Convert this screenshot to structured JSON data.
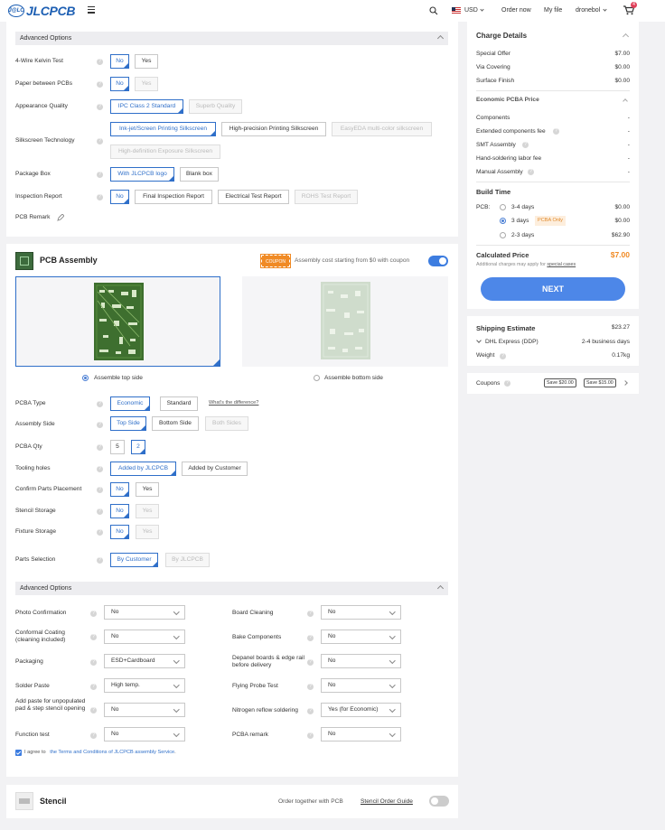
{
  "header": {
    "logo_mark": "J@LC",
    "logo_text": "JLCPCB",
    "currency": "USD",
    "order_now": "Order now",
    "my_file": "My file",
    "user": "dronebol",
    "cart_count": "4"
  },
  "adv1": {
    "title": "Advanced Options",
    "kelvin": {
      "label": "4-Wire Kelvin Test",
      "opts": [
        "No",
        "Yes"
      ]
    },
    "paper": {
      "label": "Paper between PCBs",
      "opts": [
        "No",
        "Yes"
      ]
    },
    "appearance": {
      "label": "Appearance Quality",
      "opts": [
        "IPC Class 2 Standard",
        "Superb Quality"
      ]
    },
    "silkscreen": {
      "label": "Silkscreen Technology",
      "opts": [
        "Ink-jet/Screen Printing Silkscreen",
        "High-precision Printing Silkscreen",
        "EasyEDA multi-color silkscreen",
        "High-definition Exposure Silkscreen"
      ]
    },
    "package": {
      "label": "Package Box",
      "opts": [
        "With JLCPCB logo",
        "Blank box"
      ]
    },
    "inspection": {
      "label": "Inspection Report",
      "opts": [
        "No",
        "Final Inspection Report",
        "Electrical Test Report",
        "ROHS Test Report"
      ]
    },
    "remark": {
      "label": "PCB Remark"
    }
  },
  "assembly": {
    "title": "PCB Assembly",
    "coupon_tag": "COUPON",
    "coupon_text": "Assembly cost starting from $0 with coupon",
    "side_top": "Assemble top side",
    "side_bottom": "Assemble bottom side",
    "pcba_type": {
      "label": "PCBA Type",
      "opts": [
        "Economic",
        "Standard"
      ],
      "link": "What's the difference?"
    },
    "assembly_side": {
      "label": "Assembly Side",
      "opts": [
        "Top Side",
        "Bottom Side",
        "Both Sides"
      ]
    },
    "qty": {
      "label": "PCBA Qty",
      "opts": [
        "5",
        "2"
      ]
    },
    "tooling": {
      "label": "Tooling holes",
      "opts": [
        "Added by JLCPCB",
        "Added by Customer"
      ]
    },
    "confirm": {
      "label": "Confirm Parts Placement",
      "opts": [
        "No",
        "Yes"
      ]
    },
    "stencil_storage": {
      "label": "Stencil Storage",
      "opts": [
        "No",
        "Yes"
      ]
    },
    "fixture": {
      "label": "Fixture Storage",
      "opts": [
        "No",
        "Yes"
      ]
    },
    "parts": {
      "label": "Parts Selection",
      "opts": [
        "By Customer",
        "By JLCPCB"
      ]
    }
  },
  "adv2": {
    "title": "Advanced Options",
    "left": [
      {
        "label": "Photo Confirmation",
        "value": "No"
      },
      {
        "label": "Conformal Coating (cleaning included)",
        "value": "No"
      },
      {
        "label": "Packaging",
        "value": "ESD+Cardboard"
      },
      {
        "label": "Solder Paste",
        "value": "High temp."
      },
      {
        "label": "Add paste for unpopulated pad & step stencil opening",
        "value": "No"
      },
      {
        "label": "Function test",
        "value": "No"
      }
    ],
    "right": [
      {
        "label": "Board Cleaning",
        "value": "No"
      },
      {
        "label": "Bake Components",
        "value": "No"
      },
      {
        "label": "Depanel boards & edge rail before delivery",
        "value": "No"
      },
      {
        "label": "Flying Probe Test",
        "value": "No"
      },
      {
        "label": "Nitrogen reflow soldering",
        "value": "Yes (for Economic)"
      },
      {
        "label": "PCBA remark",
        "value": "No"
      }
    ],
    "agree_prefix": "I agree to",
    "agree_link": "the Terms and Conditions of JLCPCB assembly Service",
    "agree_suffix": "."
  },
  "stencil": {
    "title": "Stencil",
    "order_together": "Order together with PCB",
    "guide": "Stencil Order Guide"
  },
  "charges": {
    "title": "Charge Details",
    "rows": [
      {
        "label": "Special Offer",
        "value": "$7.00"
      },
      {
        "label": "Via Covering",
        "value": "$0.00"
      },
      {
        "label": "Surface Finish",
        "value": "$0.00"
      }
    ],
    "economic_title": "Economic PCBA Price",
    "economic_rows": [
      {
        "label": "Components",
        "value": "-"
      },
      {
        "label": "Extended components fee",
        "value": "-"
      },
      {
        "label": "SMT Assembly",
        "value": "-"
      },
      {
        "label": "Hand-soldering labor fee",
        "value": "-"
      },
      {
        "label": "Manual Assembly",
        "value": "-"
      }
    ],
    "build_time_title": "Build Time",
    "pcb_label": "PCB:",
    "build_rows": [
      {
        "label": "3-4 days",
        "value": "$0.00"
      },
      {
        "label": "3 days",
        "badge": "PCBA Only",
        "value": "$0.00"
      },
      {
        "label": "2-3 days",
        "value": "$62.90"
      }
    ],
    "calc_label": "Calculated Price",
    "calc_value": "$7.00",
    "note_prefix": "Additional charges may apply for",
    "note_link": "special cases",
    "next": "NEXT"
  },
  "shipping": {
    "title": "Shipping Estimate",
    "price": "$23.27",
    "method": "DHL Express (DDP)",
    "days": "2-4 business days",
    "weight_label": "Weight",
    "weight": "0.17kg"
  },
  "coupons": {
    "label": "Coupons",
    "c1": "Save $20.00",
    "c2": "Save $15.00"
  }
}
